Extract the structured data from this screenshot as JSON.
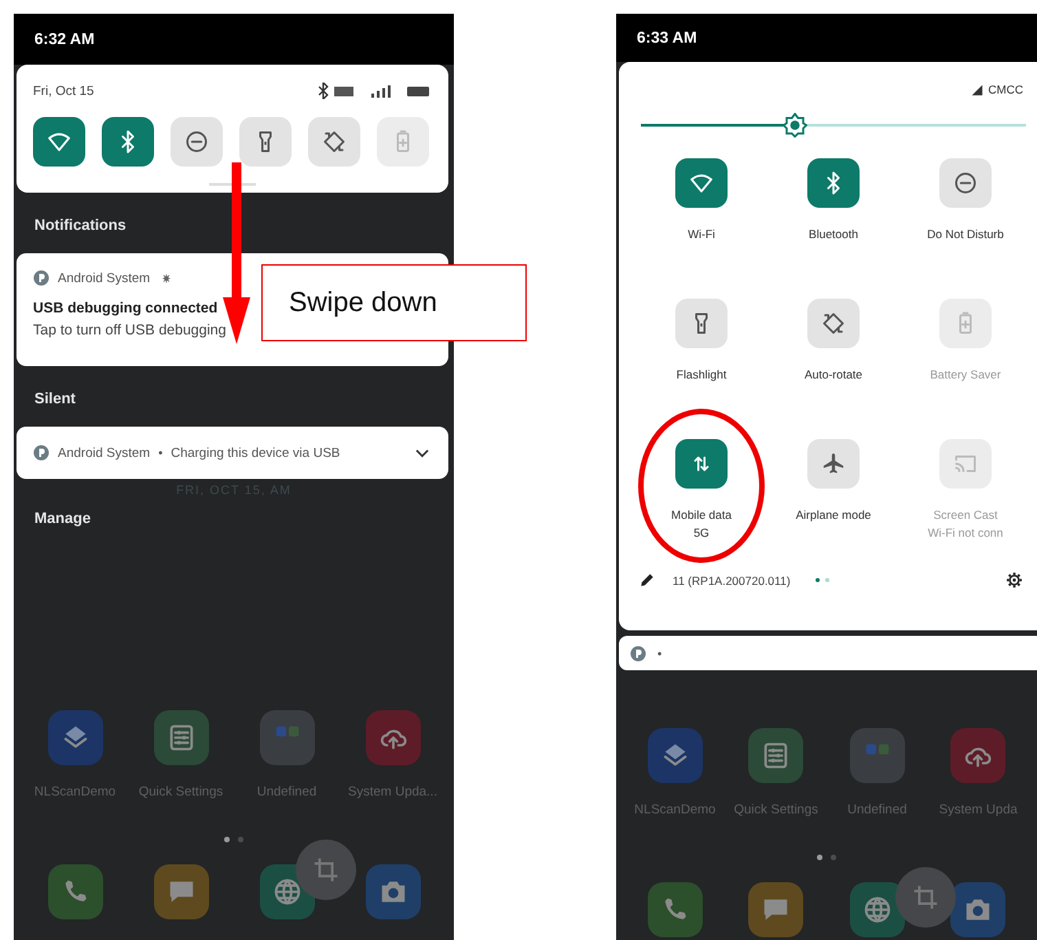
{
  "left_phone": {
    "status_bar": {
      "time": "6:32 AM"
    },
    "quick_panel": {
      "date": "Fri, Oct 15",
      "tiles": [
        {
          "kind": "wifi",
          "on": true,
          "disabled": false
        },
        {
          "kind": "bluetooth",
          "on": true,
          "disabled": false
        },
        {
          "kind": "do-not-disturb",
          "on": false,
          "disabled": false
        },
        {
          "kind": "flashlight",
          "on": false,
          "disabled": false
        },
        {
          "kind": "auto-rotate",
          "on": false,
          "disabled": false
        },
        {
          "kind": "battery-saver",
          "on": false,
          "disabled": true
        }
      ]
    },
    "sections": [
      {
        "title": "Notifications",
        "notifications": [
          {
            "kind": "full",
            "app": "Android System",
            "title": "USB debugging connected",
            "text": "Tap to turn off USB debugging"
          }
        ]
      },
      {
        "title": "Silent",
        "notifications": [
          {
            "kind": "collapsed",
            "app": "Android System",
            "separator": "•",
            "text": "Charging this device via USB",
            "expanded": false
          }
        ]
      }
    ],
    "lock_date": "FRI, OCT 15, AM",
    "manage_label": "Manage",
    "home_screen": {
      "apps": [
        {
          "label": "NLScanDemo",
          "kind": "layers",
          "color": "#1c3566"
        },
        {
          "label": "Quick Settings",
          "kind": "sliders",
          "color": "#2b4a38"
        },
        {
          "label": "Undefined",
          "kind": "folder",
          "color": "#3a3d42"
        },
        {
          "label": "System Upda...",
          "kind": "cloud",
          "color": "#5e1c28"
        }
      ],
      "page_dots": [
        {
          "selected": true
        },
        {
          "selected": false
        }
      ],
      "dock": [
        {
          "kind": "phone",
          "color": "#2c4f2c"
        },
        {
          "kind": "chat",
          "color": "#5e4a1e"
        },
        {
          "kind": "globe",
          "color": "#1c4f44"
        },
        {
          "kind": "camera",
          "color": "#1f3f69"
        }
      ]
    }
  },
  "right_phone": {
    "status_bar": {
      "time": "6:33 AM"
    },
    "carrier": "CMCC",
    "brightness": {
      "level": 0.4
    },
    "tiles": [
      {
        "kind": "wifi",
        "label": "Wi-Fi",
        "on": true,
        "disabled": false,
        "highlighted": false
      },
      {
        "kind": "bluetooth",
        "label": "Bluetooth",
        "on": true,
        "disabled": false,
        "highlighted": false
      },
      {
        "kind": "do-not-disturb",
        "label": "Do Not Disturb",
        "on": false,
        "disabled": false,
        "highlighted": false
      },
      {
        "kind": "flashlight",
        "label": "Flashlight",
        "on": false,
        "disabled": false,
        "highlighted": false
      },
      {
        "kind": "auto-rotate",
        "label": "Auto-rotate",
        "on": false,
        "disabled": false,
        "highlighted": false
      },
      {
        "kind": "battery-saver",
        "label": "Battery Saver",
        "on": false,
        "disabled": true,
        "highlighted": false
      },
      {
        "kind": "mobile-data",
        "label": "Mobile data",
        "sublabel": "5G",
        "on": true,
        "disabled": false,
        "highlighted": true
      },
      {
        "kind": "airplane-mode",
        "label": "Airplane mode",
        "on": false,
        "disabled": false,
        "highlighted": false
      },
      {
        "kind": "screen-cast",
        "label": "Screen Cast",
        "sublabel": "Wi-Fi not conn",
        "on": false,
        "disabled": true,
        "highlighted": false
      }
    ],
    "footer": {
      "build": "11 (RP1A.200720.011)",
      "pages": [
        {
          "selected": true
        },
        {
          "selected": false
        }
      ]
    },
    "peek_notification": {
      "text": "•"
    },
    "home_screen": {
      "apps": [
        {
          "label": "NLScanDemo",
          "kind": "layers",
          "color": "#1c3566"
        },
        {
          "label": "Quick Settings",
          "kind": "sliders",
          "color": "#2b4a38"
        },
        {
          "label": "Undefined",
          "kind": "folder",
          "color": "#3a3d42"
        },
        {
          "label": "System Upda",
          "kind": "cloud",
          "color": "#5e1c28"
        }
      ],
      "page_dots": [
        {
          "selected": true
        },
        {
          "selected": false
        }
      ],
      "dock": [
        {
          "kind": "phone",
          "color": "#2c4f2c"
        },
        {
          "kind": "chat",
          "color": "#5e4a1e"
        },
        {
          "kind": "globe",
          "color": "#1c4f44"
        },
        {
          "kind": "camera",
          "color": "#1f3f69"
        }
      ]
    }
  },
  "annotations": {
    "callout": "Swipe down"
  }
}
